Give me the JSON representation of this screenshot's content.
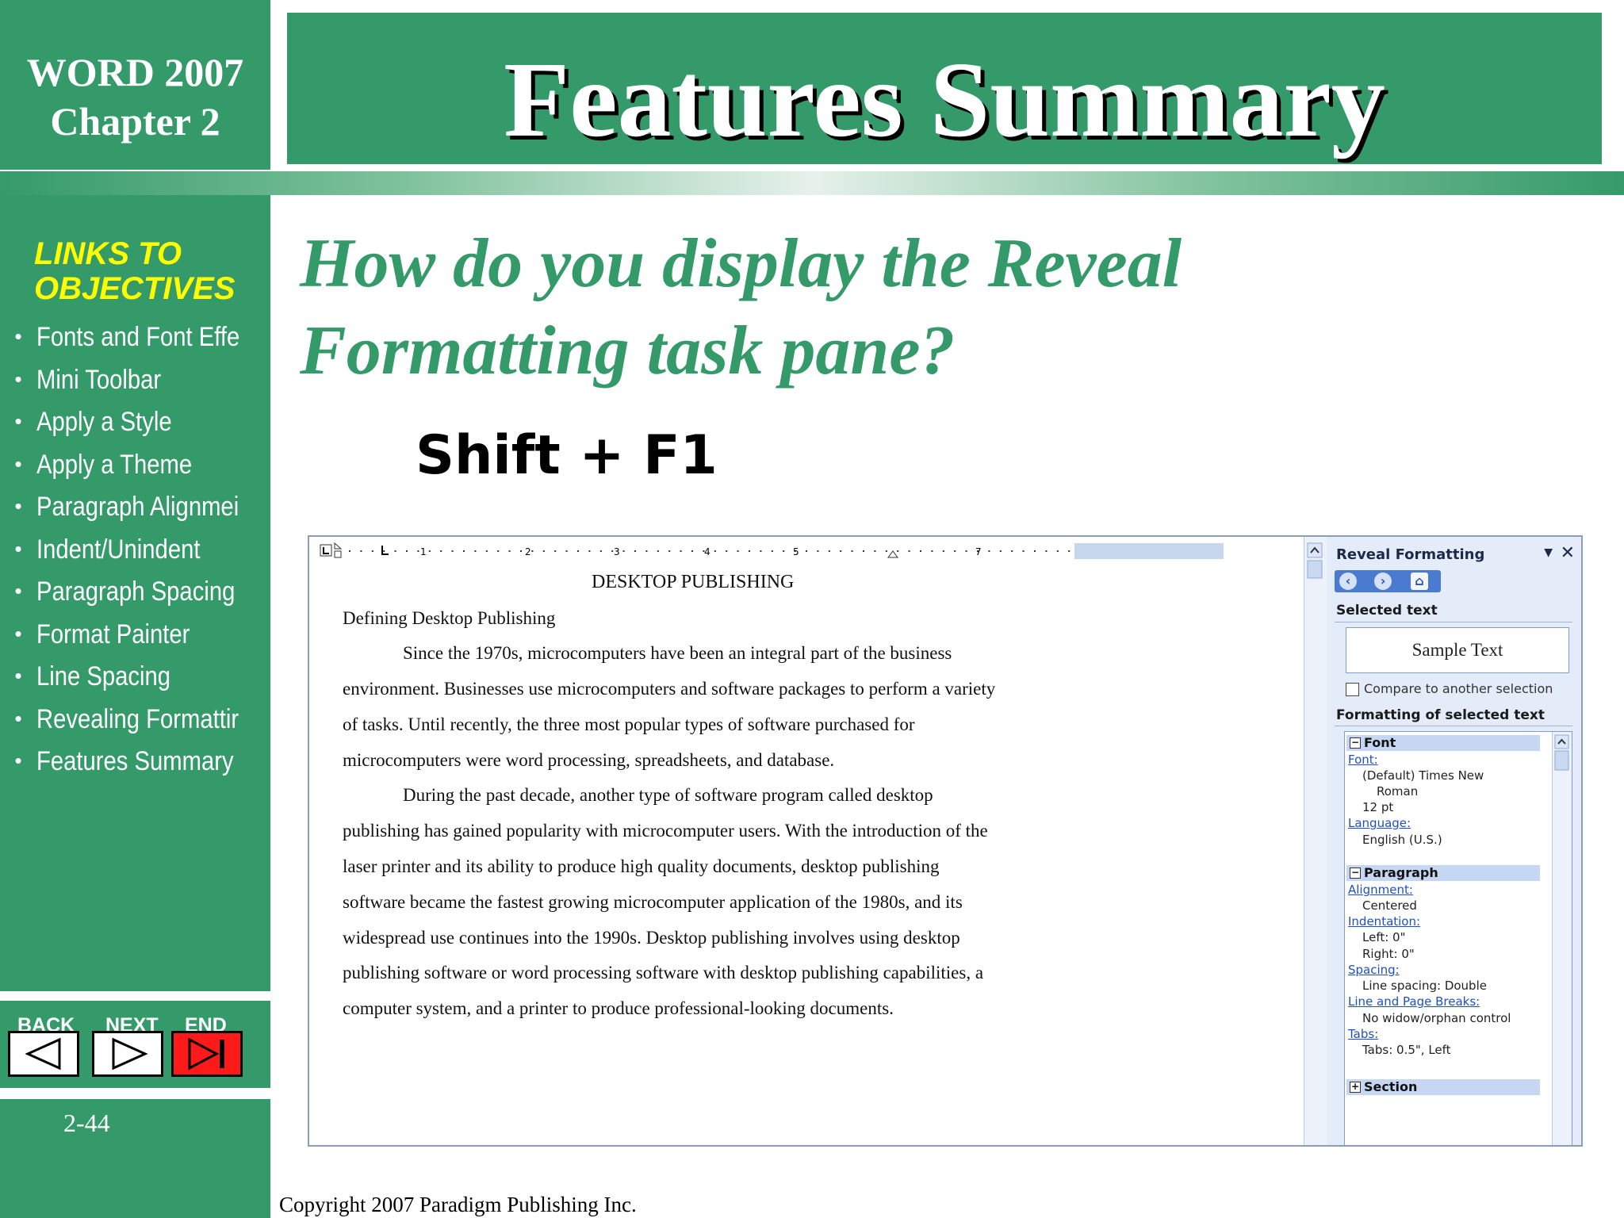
{
  "header": {
    "course_line1": "WORD 2007",
    "course_line2": "Chapter 2",
    "slide_title": "Features Summary"
  },
  "sidebar": {
    "heading_line1": "LINKS TO",
    "heading_line2": "OBJECTIVES",
    "links": [
      "Fonts and Font Effe",
      "Mini Toolbar",
      "Apply  a Style",
      "Apply a Theme",
      "Paragraph Alignmei",
      "Indent/Unindent",
      "Paragraph Spacing",
      "Format Painter",
      "Line Spacing",
      "Revealing Formattir",
      "Features Summary"
    ],
    "nav": {
      "back": "BACK",
      "next": "NEXT",
      "end": "END"
    },
    "page_number": "2-44"
  },
  "content": {
    "question_line1": "How do you display the Reveal",
    "question_line2": "Formatting task pane?",
    "shortcut": "Shift + F1",
    "copyright": "Copyright 2007 Paradigm Publishing Inc."
  },
  "screenshot": {
    "ruler_numbers": [
      "1",
      "2",
      "3",
      "4",
      "5",
      "7"
    ],
    "document": {
      "heading": "DESKTOP PUBLISHING",
      "subheading": "Defining Desktop Publishing",
      "lines": [
        "Since the 1970s, microcomputers have been an integral part of the business",
        "environment. Businesses use microcomputers and software packages to perform a variety",
        "of tasks. Until recently, the three most popular types of software purchased for",
        "microcomputers were word processing, spreadsheets, and database.",
        "During the past decade, another type of software program called desktop",
        "publishing has gained popularity with microcomputer users. With the introduction of the",
        "laser printer and its ability to produce high quality documents, desktop publishing",
        "software became the fastest growing microcomputer application of the 1980s, and its",
        "widespread use continues into the 1990s. Desktop publishing involves using desktop",
        "publishing software or word processing software with desktop publishing capabilities, a",
        "computer system, and a printer to produce professional-looking documents."
      ]
    },
    "pane": {
      "title": "Reveal Formatting",
      "selected_text_label": "Selected text",
      "sample": "Sample Text",
      "compare_label": "Compare to another selection",
      "formatting_label": "Formatting of selected text",
      "font_group": "Font",
      "font_link": "Font:",
      "font_value1": "(Default) Times New",
      "font_value2": "Roman",
      "font_size": "12 pt",
      "language_link": "Language:",
      "language_value": "English (U.S.)",
      "paragraph_group": "Paragraph",
      "alignment_link": "Alignment:",
      "alignment_value": "Centered",
      "indentation_link": "Indentation:",
      "indent_left": "Left:  0\"",
      "indent_right": "Right:  0\"",
      "spacing_link": "Spacing:",
      "spacing_value": "Line spacing:  Double",
      "breaks_link": "Line and Page Breaks:",
      "breaks_value": "No widow/orphan control",
      "tabs_link": "Tabs:",
      "tabs_value": "Tabs:  0.5\", Left",
      "section_group": "Section"
    }
  },
  "colors": {
    "brand_green": "#359a69",
    "links_yellow": "#ffff00",
    "end_red": "#ff1a1a"
  }
}
